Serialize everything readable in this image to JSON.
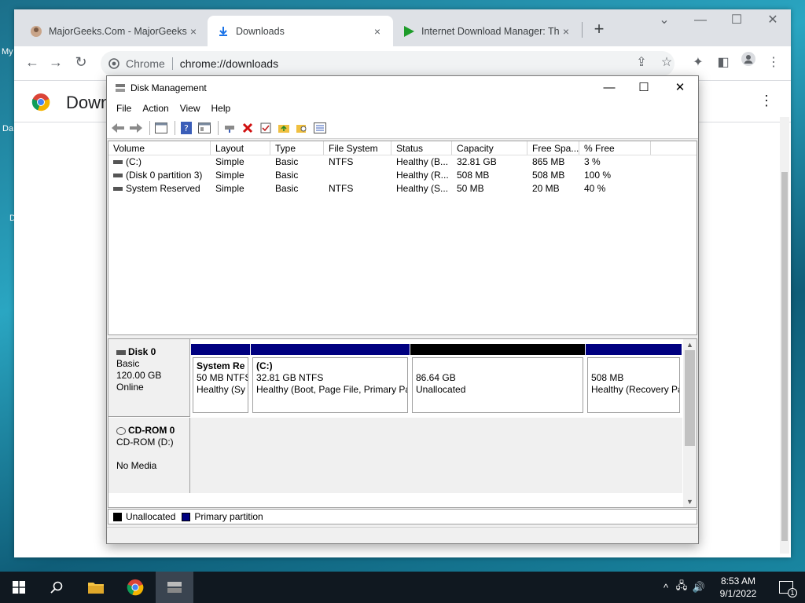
{
  "desktop": {
    "fragments": [
      "My",
      "Da",
      "D"
    ]
  },
  "browser": {
    "tabs": [
      {
        "title": "MajorGeeks.Com - MajorGeeks",
        "close": "×",
        "icon": "majorgeeks-icon"
      },
      {
        "title": "Downloads",
        "close": "×",
        "icon": "download-icon"
      },
      {
        "title": "Internet Download Manager: Th",
        "close": "×",
        "icon": "idm-icon"
      }
    ],
    "new_tab": "+",
    "window_controls": {
      "dropdown": "⌄",
      "minimize": "—",
      "maximize": "☐",
      "close": "✕"
    },
    "address": {
      "site_label": "Chrome",
      "url": "chrome://downloads"
    },
    "page_title": "Downloads",
    "menu_dots": "⋮"
  },
  "disk_mgmt": {
    "title": "Disk Management",
    "controls": {
      "minimize": "—",
      "maximize": "☐",
      "close": "✕"
    },
    "menu": [
      "File",
      "Action",
      "View",
      "Help"
    ],
    "columns": [
      "Volume",
      "Layout",
      "Type",
      "File System",
      "Status",
      "Capacity",
      "Free Spa...",
      "% Free"
    ],
    "volumes": [
      {
        "volume": "(C:)",
        "layout": "Simple",
        "type": "Basic",
        "fs": "NTFS",
        "status": "Healthy (B...",
        "capacity": "32.81 GB",
        "free": "865 MB",
        "pct": "3 %"
      },
      {
        "volume": "(Disk 0 partition 3)",
        "layout": "Simple",
        "type": "Basic",
        "fs": "",
        "status": "Healthy (R...",
        "capacity": "508 MB",
        "free": "508 MB",
        "pct": "100 %"
      },
      {
        "volume": "System Reserved",
        "layout": "Simple",
        "type": "Basic",
        "fs": "NTFS",
        "status": "Healthy (S...",
        "capacity": "50 MB",
        "free": "20 MB",
        "pct": "40 %"
      }
    ],
    "disk0": {
      "name": "Disk 0",
      "type": "Basic",
      "size": "120.00 GB",
      "state": "Online",
      "partitions": [
        {
          "name": "System Re",
          "size": "50 MB NTFS",
          "status": "Healthy (Sy",
          "kind": "primary"
        },
        {
          "name": "(C:)",
          "size": "32.81 GB NTFS",
          "status": "Healthy (Boot, Page File, Primary Pa",
          "kind": "primary"
        },
        {
          "name": "",
          "size": "86.64 GB",
          "status": "Unallocated",
          "kind": "unallocated"
        },
        {
          "name": "",
          "size": "508 MB",
          "status": "Healthy (Recovery Pa",
          "kind": "primary"
        }
      ]
    },
    "cdrom": {
      "name": "CD-ROM 0",
      "type": "CD-ROM (D:)",
      "media": "No Media"
    },
    "legend": [
      {
        "label": "Unallocated",
        "color": "#000000"
      },
      {
        "label": "Primary partition",
        "color": "#000080"
      }
    ]
  },
  "taskbar": {
    "clock_time": "8:53 AM",
    "clock_date": "9/1/2022",
    "notifications": "1"
  }
}
